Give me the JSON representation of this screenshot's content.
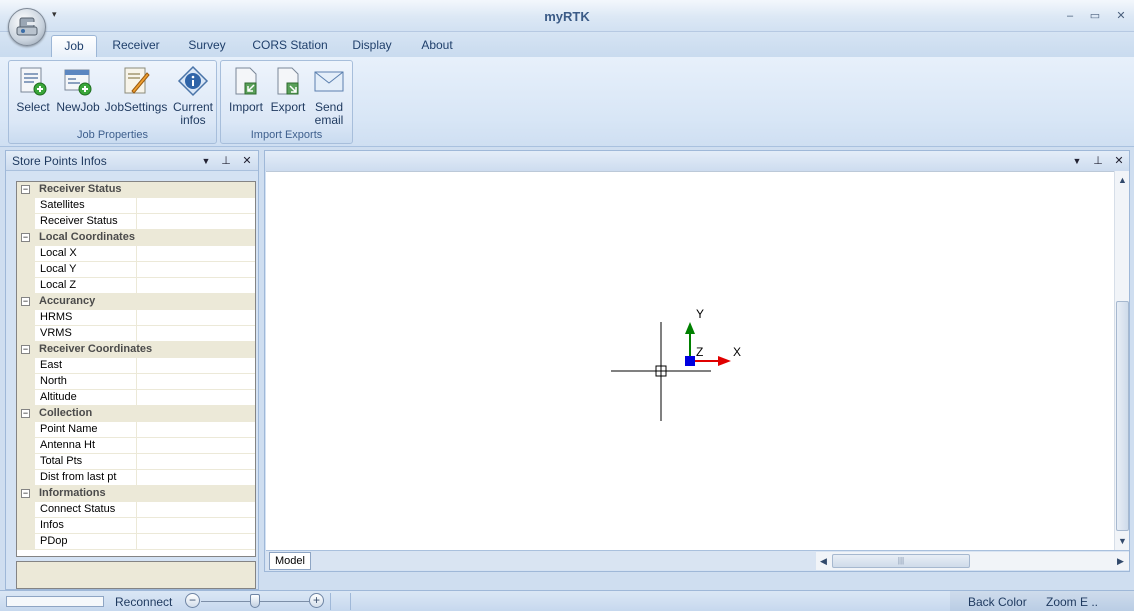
{
  "window": {
    "title": "myRTK",
    "qat_arrow": "▾",
    "minimize": "–",
    "maximize": "▭",
    "close": "✕"
  },
  "tabs": [
    {
      "label": "Job",
      "active": true
    },
    {
      "label": "Receiver",
      "active": false
    },
    {
      "label": "Survey",
      "active": false
    },
    {
      "label": "CORS Station",
      "active": false
    },
    {
      "label": "Display",
      "active": false
    },
    {
      "label": "About",
      "active": false
    }
  ],
  "ribbon": {
    "job_properties": {
      "label": "Job Properties",
      "buttons": [
        {
          "label": "Select",
          "icon": "select-job-icon"
        },
        {
          "label": "NewJob",
          "icon": "new-job-icon"
        },
        {
          "label": "JobSettings",
          "icon": "job-settings-icon"
        },
        {
          "label_line1": "Current",
          "label_line2": "infos",
          "icon": "info-icon"
        }
      ]
    },
    "import_exports": {
      "label": "Import Exports",
      "buttons": [
        {
          "label": "Import",
          "icon": "import-icon"
        },
        {
          "label": "Export",
          "icon": "export-icon"
        },
        {
          "label_line1": "Send",
          "label_line2": "email",
          "icon": "email-icon"
        }
      ]
    }
  },
  "left_panel": {
    "title": "Store Points Infos",
    "dropdown": "▼",
    "pin": "⊥",
    "close": "✕",
    "collapse_glyph": "−",
    "categories": [
      {
        "label": "Receiver Status",
        "rows": [
          "Satellites",
          "Receiver Status"
        ]
      },
      {
        "label": "Local Coordinates",
        "rows": [
          "Local X",
          "Local Y",
          "Local Z"
        ]
      },
      {
        "label": "Accurancy",
        "rows": [
          "HRMS",
          "VRMS"
        ]
      },
      {
        "label": "Receiver Coordinates",
        "rows": [
          "East",
          "North",
          "Altitude"
        ]
      },
      {
        "label": "Collection",
        "rows": [
          "Point Name",
          "Antenna Ht",
          "Total Pts",
          "Dist from last pt"
        ]
      },
      {
        "label": "Informations",
        "rows": [
          "Connect Status",
          "Infos",
          "PDop"
        ]
      }
    ]
  },
  "drawing_panel": {
    "dropdown": "▼",
    "pin": "⊥",
    "close": "✕",
    "axis_y": "Y",
    "axis_z": "Z",
    "axis_x": "X",
    "model_tab": "Model",
    "scroll_up": "▲",
    "scroll_down": "▼",
    "scroll_left": "◀",
    "scroll_right": "▶",
    "grip": "|||",
    "colors": {
      "x_axis": "#e00000",
      "y_axis": "#008000",
      "origin": "#0000e0"
    }
  },
  "statusbar": {
    "reconnect": "Reconnect",
    "zoom_out": "−",
    "zoom_in": "+",
    "back_color": "Back Color",
    "zoom_extents": "Zoom E .."
  }
}
